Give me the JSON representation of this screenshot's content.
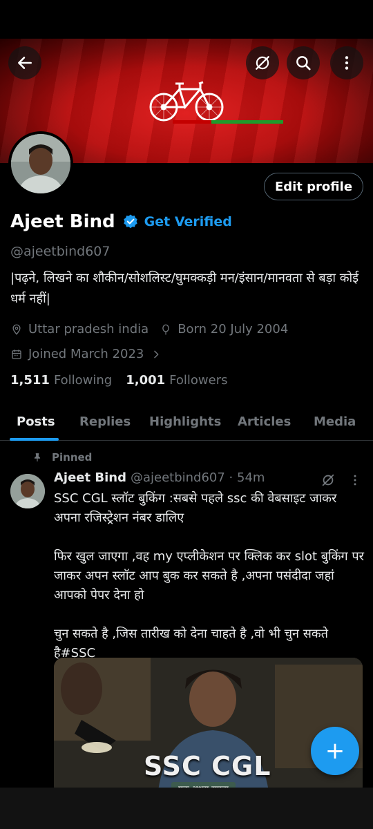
{
  "header": {
    "back_icon": "arrow-left-icon",
    "grok_icon": "slash-circle-icon",
    "search_icon": "search-icon",
    "more_icon": "more-vertical-icon"
  },
  "profile": {
    "name": "Ajeet Bind",
    "get_verified": "Get Verified",
    "handle": "@ajeetbind607",
    "bio": "|पढ़ने, लिखने का शौकीन/सोशलिस्ट/घुमक्कड़ी मन/इंसान/मानवता से बड़ा कोई धर्म नहीं|",
    "location": "Uttar pradesh india",
    "born": "Born 20 July 2004",
    "joined": "Joined March 2023",
    "following_count": "1,511",
    "following_label": "Following",
    "followers_count": "1,001",
    "followers_label": "Followers",
    "edit_label": "Edit profile"
  },
  "tabs": [
    {
      "label": "Posts"
    },
    {
      "label": "Replies"
    },
    {
      "label": "Highlights"
    },
    {
      "label": "Articles"
    },
    {
      "label": "Media"
    }
  ],
  "post": {
    "pinned_label": "Pinned",
    "author": "Ajeet Bind",
    "handle_time": "@ajeetbind607 · 54m",
    "text": "SSC CGL स्लॉट बुकिंग :सबसे पहले ssc की वेबसाइट जाकर अपना रजिस्ट्रेशन नंबर डालिए\n\nफिर खुल जाएगा ,वह my एप्लीकेशन पर क्लिक कर slot बुकिंग पर जाकर अपन स्लॉट आप बुक कर सकते है ,अपना पसंदीदा जहां आपको  पेपर देना हो\n\nचुन सकते है ,जिस तारीख को देना चाहते है ,वो भी चुन सकते है#SSC",
    "media_title": "SSC CGL",
    "media_subtitle": "एक अधूरा सपना"
  },
  "colors": {
    "accent": "#1d9bf0",
    "banner": "#c40000",
    "muted": "#71767b"
  }
}
